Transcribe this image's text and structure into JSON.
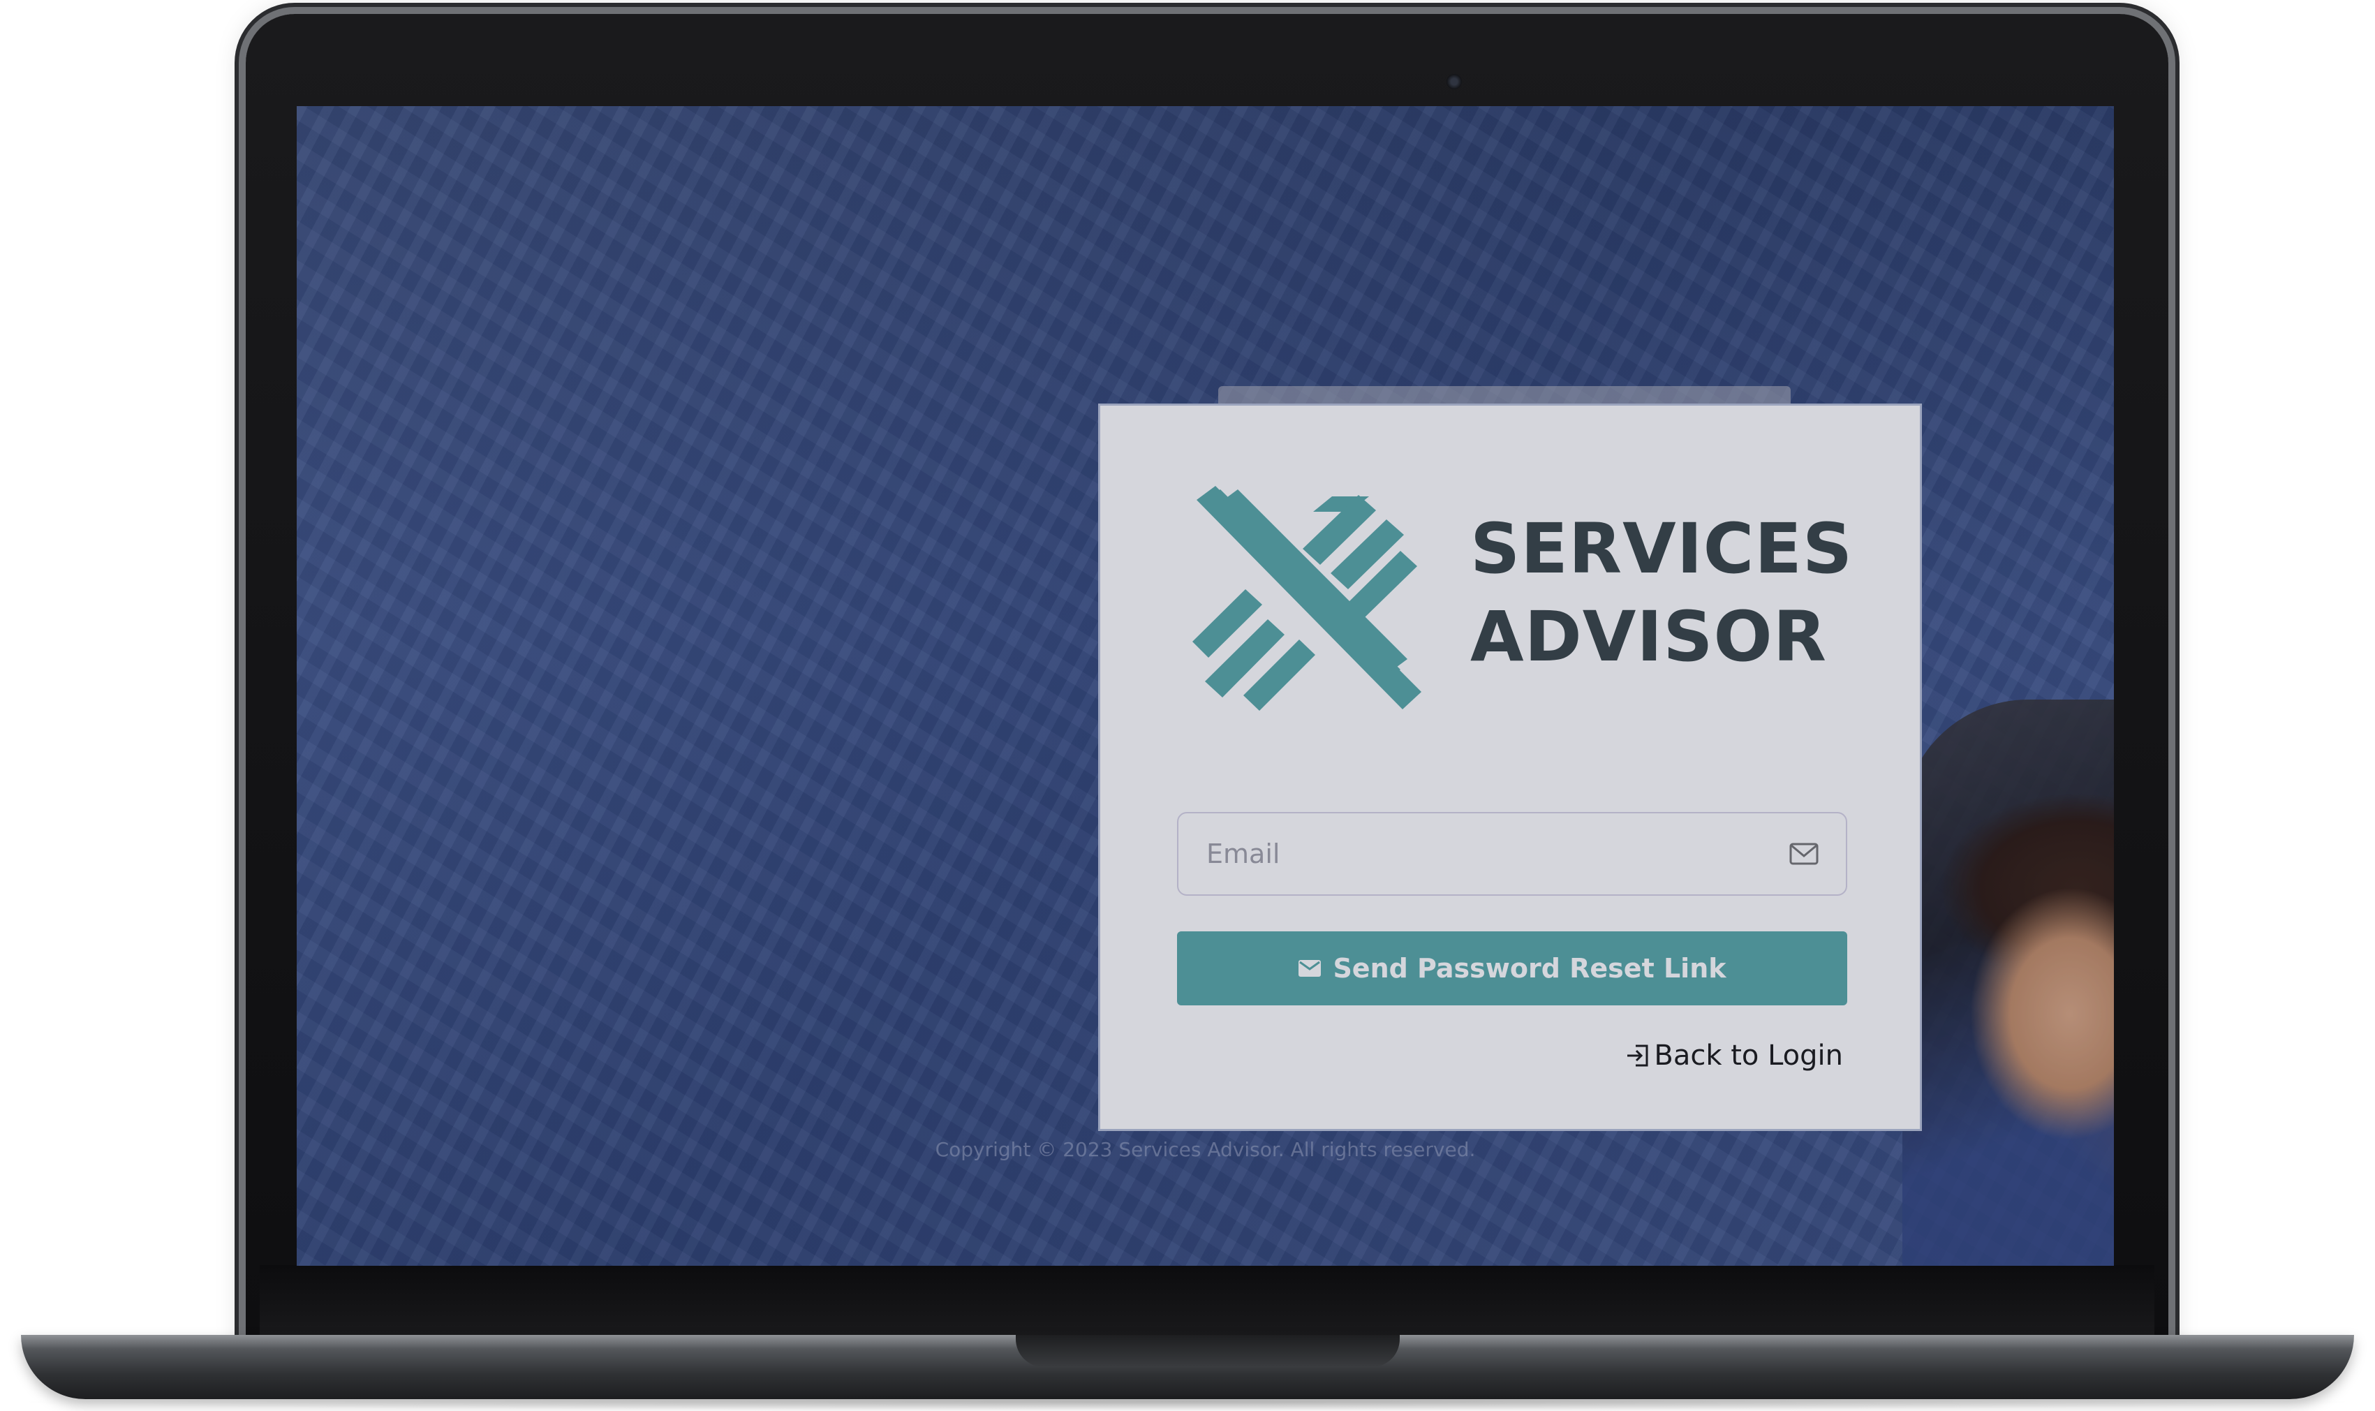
{
  "brand": {
    "line1": "SERVICES",
    "line2": "ADVISOR",
    "accent_color": "#5aa9a9",
    "text_color": "#3a4648"
  },
  "form": {
    "email_placeholder": "Email",
    "email_value": "",
    "email_icon": "mail-icon",
    "submit_label": "Send Password Reset Link",
    "submit_icon": "envelope-icon",
    "back_label": "Back to Login",
    "back_icon": "login-icon"
  },
  "footer": {
    "copyright": "Copyright © 2023 Services Advisor. All rights reserved."
  }
}
